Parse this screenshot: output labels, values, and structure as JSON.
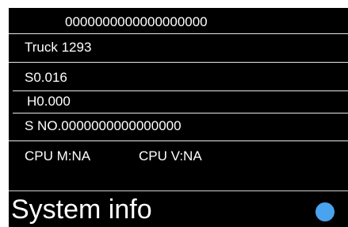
{
  "header": {
    "serial": "0000000000000000000"
  },
  "info": {
    "vehicle": "Truck 1293",
    "s_value": "S0.016",
    "h_value": "H0.000",
    "s_no": "S NO.0000000000000000",
    "cpu_m": "CPU  M:NA",
    "cpu_v": "CPU  V:NA"
  },
  "footer": {
    "title": "System info",
    "status_color": "#4aa3ee"
  }
}
